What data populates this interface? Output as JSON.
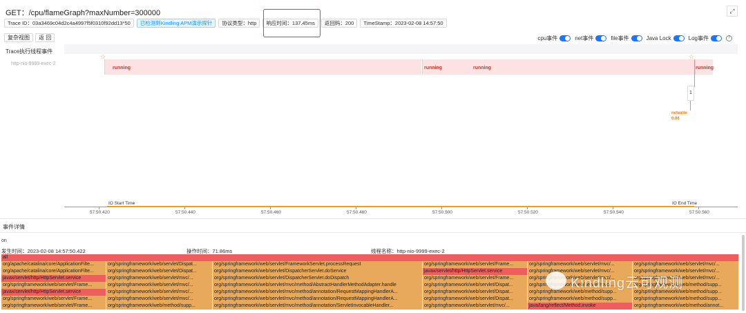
{
  "header": {
    "title": "GET：/cpu/flameGraph?maxNumber=300000",
    "expand_icon": "expand-icon"
  },
  "meta": {
    "trace_id": "Trace ID：03a3469c04d2c4a4997f5f0310f92dd13*50",
    "apm_badge": "已检测到Kindling APM演示探针",
    "protocol": "协议类型：http",
    "response_time": "响应时间：137.45ms",
    "return_code": "返回码：200",
    "timestamp": "TimeStamp：2023-02-08 14:57:50"
  },
  "buttons": {
    "restore": "复杂视图",
    "back": "返 回"
  },
  "toggles": [
    {
      "label": "cpu事件",
      "on": true
    },
    {
      "label": "net事件",
      "on": true
    },
    {
      "label": "file事件",
      "on": true
    },
    {
      "label": "Java Lock",
      "on": true
    },
    {
      "label": "Log事件",
      "on": true
    }
  ],
  "timeline": {
    "section_label": "Trace执行线程事件",
    "thread_label": "http-nio-9999-exec-2",
    "running_label": "running",
    "callout_value": "1",
    "net_label_1": "netwrite",
    "net_label_2": "0.06",
    "io_start": "IO Start Time",
    "io_end": "IO End Time",
    "ticks": [
      "57:50.420",
      "57:50.440",
      "57:50.460",
      "57:50.480",
      "57:50.500",
      "57:50.520",
      "57:50.540",
      "57:50.560"
    ]
  },
  "details": {
    "title": "事件详情",
    "on_label": "on",
    "occur_time": "发生时间：2023-02-08 14:57:50.422",
    "op_time": "操作时间：71.86ms",
    "thread_name": "线程名称：http-nio-9999-exec-2"
  },
  "flame": {
    "root": "all",
    "rows": [
      [
        "org/apache/catalina/core/ApplicationFilte...",
        "org/springframework/web/servlet/Dispat...",
        "org/springframework/web/servlet/FrameworkServlet.processRequest",
        "org/springframework/web/servlet/Frame...",
        "org/springframework/web/servlet/mvc/...",
        "org/springframework/web/servlet/mvc/..."
      ],
      [
        "org/apache/catalina/core/ApplicationFilte...",
        "org/springframework/web/servlet/Dispat...",
        "org/springframework/web/servlet/DispatcherServlet.doService",
        "javax/servlet/http/HttpServlet.service",
        "org/springframework/web/servlet/mvc/...",
        "org/springframework/web/servlet/mvc/..."
      ],
      [
        "javax/servlet/http/HttpServlet.service",
        "org/springframework/web/servlet/mvc/...",
        "org/springframework/web/servlet/DispatcherServlet.doDispatch",
        "org/springframework/web/servlet/Frame...",
        "org/springframework/web/servlet/mvc/...",
        "org/springframework/web/servlet/mvc/..."
      ],
      [
        "org/springframework/web/servlet/Frame...",
        "org/springframework/web/servlet/mvc/...",
        "org/springframework/web/servlet/mvc/method/AbstractHandlerMethodAdapter.handle",
        "org/springframework/web/servlet/Dispat...",
        "org/springframework/web/servlet/mvc/...",
        "org/springframework/web/method/supp..."
      ],
      [
        "javax/servlet/http/HttpServlet.service",
        "org/springframework/web/servlet/mvc/...",
        "org/springframework/web/servlet/mvc/method/annotation/RequestMappingHandlerA...",
        "org/springframework/web/servlet/Dispat...",
        "org/springframework/web/method/supp...",
        "org/springframework/web/method/supp..."
      ],
      [
        "org/springframework/web/servlet/Frame...",
        "org/springframework/web/servlet/mvc/...",
        "org/springframework/web/servlet/mvc/method/annotation/RequestMappingHandlerA...",
        "org/springframework/web/servlet/Dispat...",
        "org/springframework/web/method/supp...",
        "org/springframework/web/method/supp..."
      ],
      [
        "org/springframework/web/servlet/Frame...",
        "org/springframework/web/method/supp...",
        "org/springframework/web/servlet/mvc/method/annotation/ServletInvocableHandler...",
        "org/springframework/web/servlet/mvc/...",
        "java/lang/reflect/Method.invoke",
        "org/springframework/web/method/annot..."
      ]
    ],
    "red_cells": [
      [
        1,
        3
      ],
      [
        2,
        0
      ],
      [
        4,
        0
      ],
      [
        6,
        4
      ]
    ]
  },
  "watermark": "Kindling云可观测"
}
